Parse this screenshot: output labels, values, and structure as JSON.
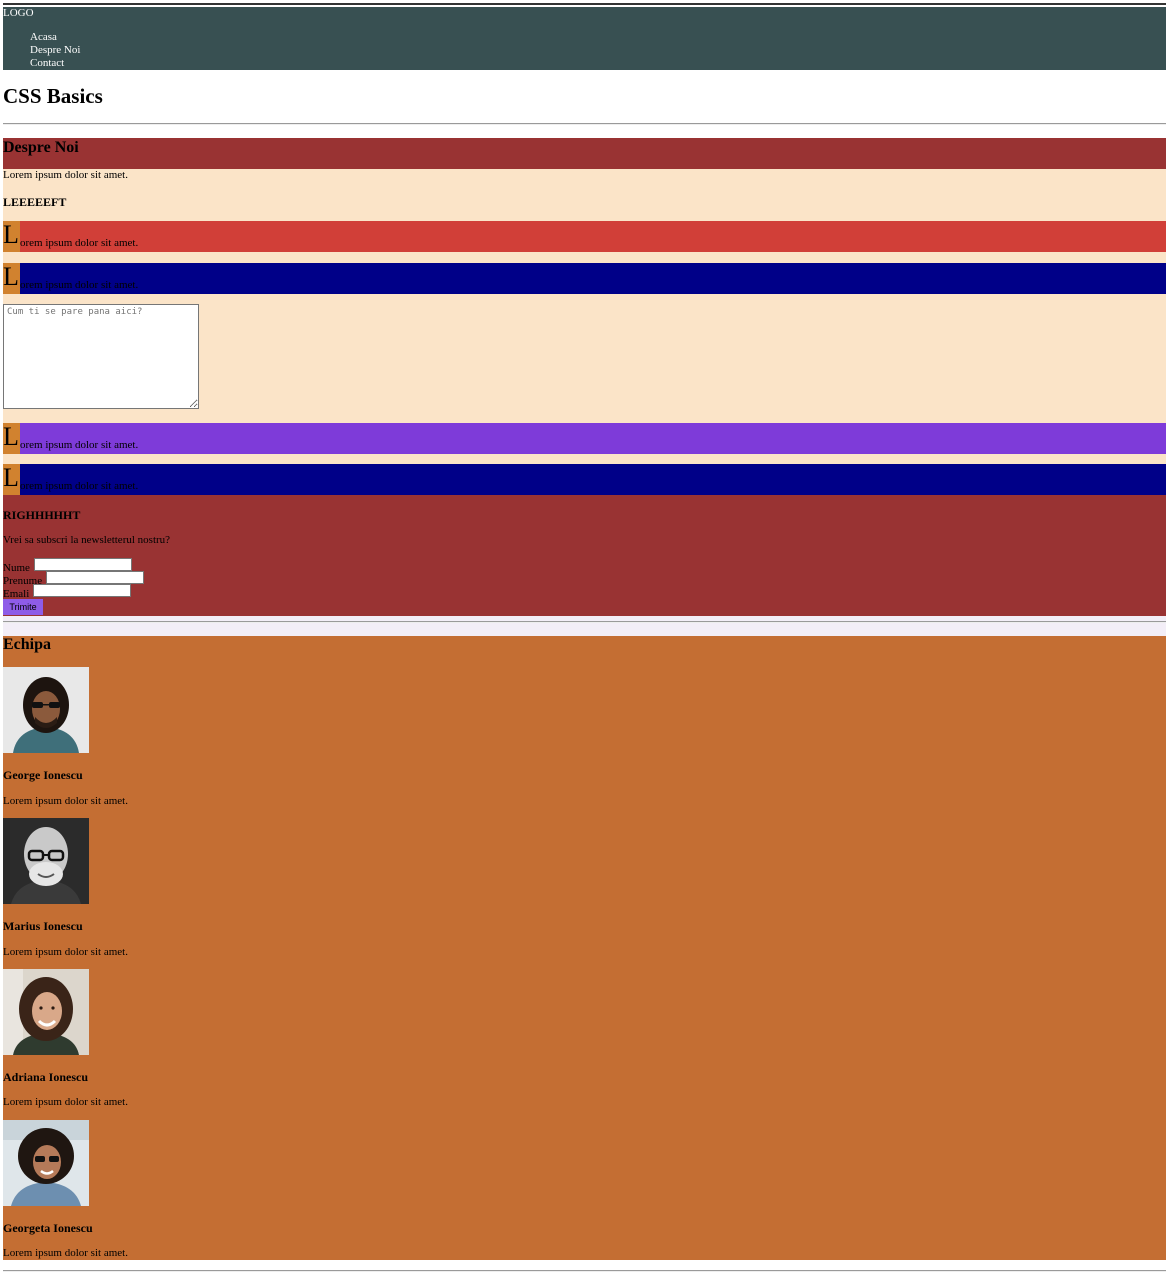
{
  "header": {
    "logo": "LOGO",
    "nav": [
      "Acasa",
      "Despre Noi",
      "Contact"
    ]
  },
  "page_title": "CSS Basics",
  "about": {
    "heading": "Despre Noi",
    "intro": "Lorem ipsum dolor sit amet.",
    "left_heading": "LEEEEEFT",
    "bars": [
      {
        "dropcap": "L",
        "text": "orem ipsum dolor sit amet.",
        "color": "#d13f38"
      },
      {
        "dropcap": "L",
        "text": "orem ipsum dolor sit amet.",
        "color": "#000088"
      },
      {
        "dropcap": "L",
        "text": "orem ipsum dolor sit amet.",
        "color": "#7e3bd9"
      },
      {
        "dropcap": "L",
        "text": "orem ipsum dolor sit amet.",
        "color": "#000088"
      }
    ],
    "feedback_placeholder": "Cum ti se pare pana aici?"
  },
  "newsletter": {
    "heading": "RIGHHHHHT",
    "question": "Vrei sa subscri la newsletterul nostru?",
    "fields": [
      {
        "label": "Nume",
        "value": ""
      },
      {
        "label": "Prenume",
        "value": ""
      },
      {
        "label": "Emali",
        "value": ""
      }
    ],
    "submit_label": "Trimite"
  },
  "team": {
    "heading": "Echipa",
    "members": [
      {
        "name": "George Ionescu",
        "desc": "Lorem ipsum dolor sit amet.",
        "photo": "man-sunglasses-curly-hair"
      },
      {
        "name": "Marius Ionescu",
        "desc": "Lorem ipsum dolor sit amet.",
        "photo": "bald-man-glasses-bw"
      },
      {
        "name": "Adriana Ionescu",
        "desc": "Lorem ipsum dolor sit amet.",
        "photo": "woman-smiling-curly-hair"
      },
      {
        "name": "Georgeta Ionescu",
        "desc": "Lorem ipsum dolor sit amet.",
        "photo": "woman-sunglasses-curly-hair"
      }
    ]
  },
  "colors": {
    "header_bg": "#385052",
    "about_heading_bg": "#993333",
    "left_bg": "#fbe4c8",
    "dropcap_bg": "#d1822f",
    "right_bg": "#993333",
    "submit_bg": "#8e5ce8",
    "team_bg": "#c46e33"
  }
}
